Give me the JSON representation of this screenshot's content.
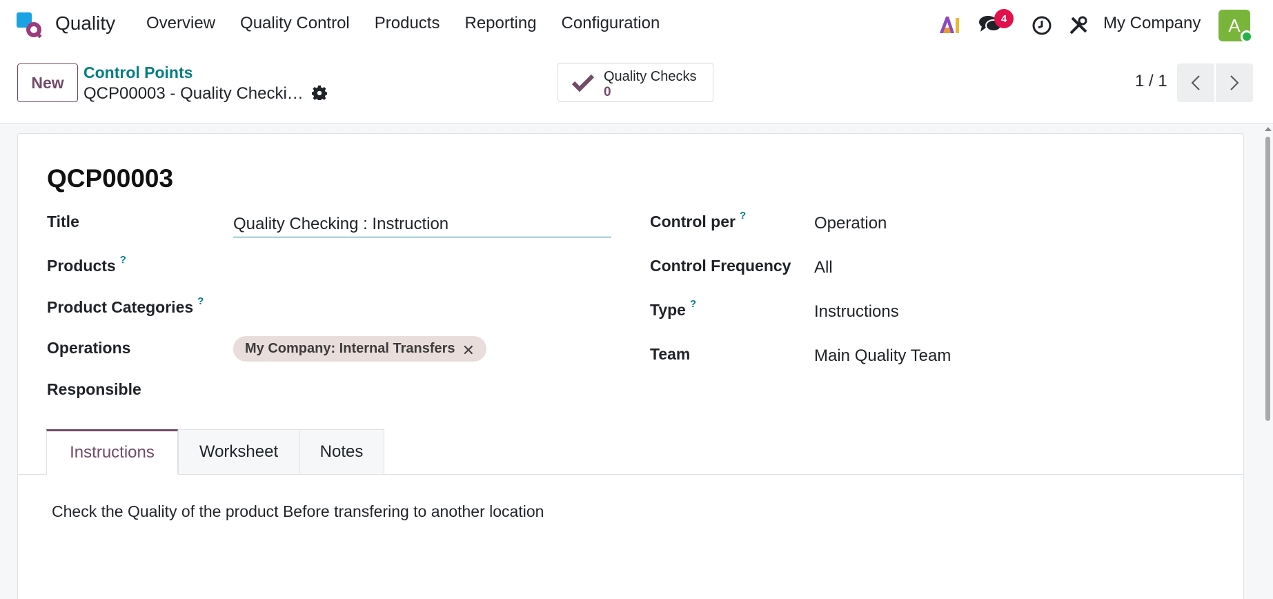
{
  "navbar": {
    "app_name": "Quality",
    "menu": [
      "Overview",
      "Quality Control",
      "Products",
      "Reporting",
      "Configuration"
    ],
    "notification_count": "4",
    "company": "My Company",
    "avatar_initial": "A"
  },
  "control_panel": {
    "new_label": "New",
    "breadcrumb": "Control Points",
    "record_title": "QCP00003 - Quality Checking : Instruction",
    "smart_button": {
      "label": "Quality Checks",
      "value": "0"
    },
    "pager": "1 / 1"
  },
  "form": {
    "reference": "QCP00003",
    "left": {
      "title_label": "Title",
      "title_value": "Quality Checking : Instruction",
      "products_label": "Products",
      "product_categories_label": "Product Categories",
      "operations_label": "Operations",
      "operations_tag": "My Company: Internal Transfers",
      "responsible_label": "Responsible"
    },
    "right": {
      "control_per_label": "Control per",
      "control_per_value": "Operation",
      "control_frequency_label": "Control Frequency",
      "control_frequency_value": "All",
      "type_label": "Type",
      "type_value": "Instructions",
      "team_label": "Team",
      "team_value": "Main Quality Team"
    },
    "help_mark": "?",
    "tabs": [
      "Instructions",
      "Worksheet",
      "Notes"
    ],
    "instructions_text": "Check the Quality of the product Before transfering to another location"
  },
  "colors": {
    "brand": "#714b67",
    "accent": "#017e84",
    "badge": "#e3114b",
    "avatar": "#79b53a"
  }
}
